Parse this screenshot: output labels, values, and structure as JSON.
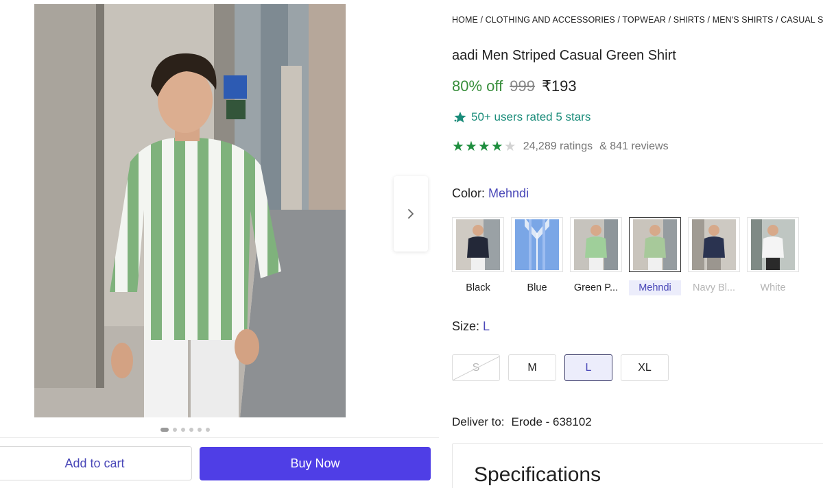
{
  "breadcrumb": [
    "HOME",
    "CLOTHING AND ACCESSORIES",
    "TOPWEAR",
    "SHIRTS",
    "MEN'S SHIRTS",
    "CASUAL SHIRTS"
  ],
  "product": {
    "title": "aadi Men Striped Casual Green Shirt",
    "discount": "80% off",
    "mrp": "999",
    "price": "₹193",
    "rated_badge": "50+ users rated 5 stars",
    "rating_stars": 4,
    "ratings_text": "24,289 ratings",
    "reviews_text": "& 841 reviews"
  },
  "color": {
    "label": "Color:",
    "selected": "Mehndi",
    "options": [
      {
        "name": "Black",
        "shirt": "#232838",
        "state": "normal"
      },
      {
        "name": "Blue",
        "shirt": "#7aa6e6",
        "state": "normal"
      },
      {
        "name": "Green P...",
        "shirt": "#9fcf9a",
        "state": "normal"
      },
      {
        "name": "Mehndi",
        "shirt": "#a7c99a",
        "state": "selected"
      },
      {
        "name": "Navy Bl...",
        "shirt": "#2a3350",
        "state": "muted"
      },
      {
        "name": "White",
        "shirt": "#f4f4f4",
        "state": "muted"
      }
    ]
  },
  "size": {
    "label": "Size:",
    "selected": "L",
    "options": [
      {
        "name": "S",
        "state": "unavailable"
      },
      {
        "name": "M",
        "state": "normal"
      },
      {
        "name": "L",
        "state": "selected"
      },
      {
        "name": "XL",
        "state": "normal"
      }
    ]
  },
  "delivery": {
    "label": "Deliver to:",
    "location": "Erode - 638102"
  },
  "specifications": {
    "title": "Specifications"
  },
  "actions": {
    "add_to_cart": "Add to cart",
    "buy_now": "Buy Now"
  },
  "gallery": {
    "dot_count": 6,
    "active_dot": 0
  },
  "colors": {
    "accent": "#4f3ee6",
    "discount_green": "#388e3c",
    "star_green": "#1e8e3e",
    "badge_teal": "#1a8c7a",
    "link_blue": "#4a48b8"
  },
  "icons": {
    "next": "chevron-right-icon",
    "badge": "sparkle-star-icon",
    "star": "star-icon"
  }
}
